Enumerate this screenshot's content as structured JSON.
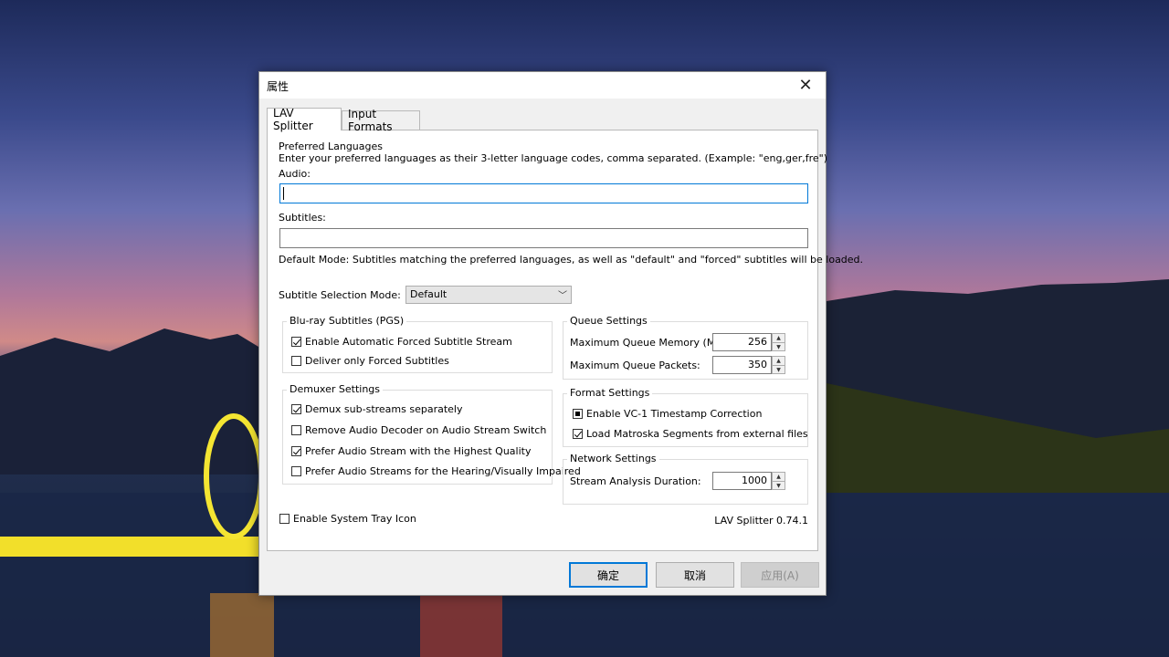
{
  "dialog": {
    "title": "属性",
    "tabs": [
      {
        "label": "LAV Splitter"
      },
      {
        "label": "Input Formats"
      }
    ]
  },
  "languages": {
    "header": "Preferred Languages",
    "description": "Enter your preferred languages as their 3-letter language codes, comma separated. (Example: \"eng,ger,fre\")",
    "audio_label": "Audio:",
    "audio_value": "",
    "subtitles_label": "Subtitles:",
    "subtitles_value": "",
    "mode_note": "Default Mode: Subtitles matching the preferred languages, as well as \"default\" and \"forced\" subtitles will be loaded.",
    "selection_mode_label": "Subtitle Selection Mode:",
    "selection_mode_value": "Default"
  },
  "bluray": {
    "title": "Blu-ray Subtitles (PGS)",
    "items": [
      {
        "label": "Enable Automatic Forced Subtitle Stream",
        "checked": true
      },
      {
        "label": "Deliver only Forced Subtitles",
        "checked": false
      }
    ]
  },
  "demuxer": {
    "title": "Demuxer Settings",
    "items": [
      {
        "label": "Demux sub-streams separately",
        "checked": true
      },
      {
        "label": "Remove Audio Decoder on Audio Stream Switch",
        "checked": false
      },
      {
        "label": "Prefer Audio Stream with the Highest Quality",
        "checked": true
      },
      {
        "label": "Prefer Audio Streams for the Hearing/Visually Impaired",
        "checked": false
      }
    ]
  },
  "queue": {
    "title": "Queue Settings",
    "memory_label": "Maximum Queue Memory (MB):",
    "memory_value": "256",
    "packets_label": "Maximum Queue Packets:",
    "packets_value": "350"
  },
  "format": {
    "title": "Format Settings",
    "items": [
      {
        "label": "Enable VC-1 Timestamp Correction",
        "state": "indeterminate"
      },
      {
        "label": "Load Matroska Segments from external files",
        "checked": true
      }
    ]
  },
  "network": {
    "title": "Network Settings",
    "duration_label": "Stream Analysis Duration:",
    "duration_value": "1000"
  },
  "tray": {
    "label": "Enable System Tray Icon",
    "checked": false
  },
  "version": "LAV Splitter 0.74.1",
  "buttons": {
    "ok": "确定",
    "cancel": "取消",
    "apply": "应用(A)"
  },
  "colors": {
    "accent": "#0078d7",
    "dialog_bg": "#f0f0f0"
  }
}
